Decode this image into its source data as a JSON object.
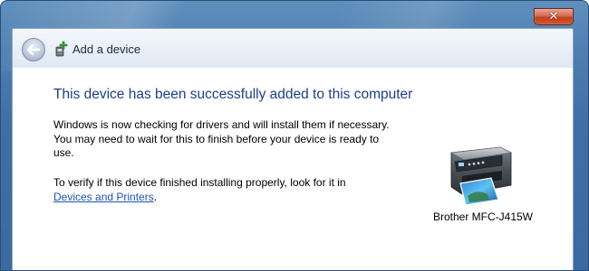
{
  "window": {
    "close_glyph": "✕"
  },
  "nav": {
    "title": "Add a device",
    "back_icon": "back-arrow-icon",
    "wizard_icon": "add-device-icon"
  },
  "content": {
    "heading": "This device has been successfully added to this computer",
    "paragraph1": "Windows is now checking for drivers and will install them if necessary. You may need to wait for this to finish before your device is ready to use.",
    "paragraph2_prefix": "To verify if this device finished installing properly, look for it in",
    "paragraph2_link": "Devices and Printers",
    "paragraph2_suffix": ".",
    "device_name": "Brother MFC-J415W",
    "device_icon": "printer-icon"
  },
  "colors": {
    "heading": "#1e3d8c",
    "link": "#1b52b8",
    "frame": "#3f6fa5",
    "close_button": "#c23f1f"
  }
}
